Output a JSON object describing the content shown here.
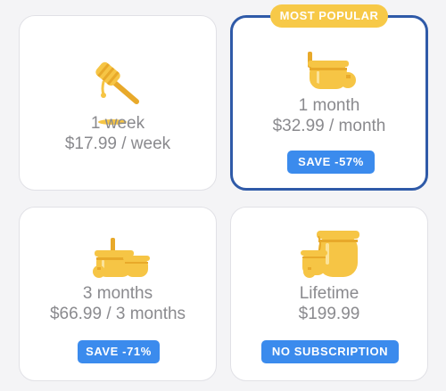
{
  "plans": [
    {
      "title": "1 week",
      "price": "$17.99 / week",
      "icon": "honey-dipper-icon"
    },
    {
      "title": "1 month",
      "price": "$32.99 / month",
      "icon": "honey-jar-small-icon",
      "badge": "MOST POPULAR",
      "button": "SAVE -57%"
    },
    {
      "title": "3 months",
      "price": "$66.99 / 3 months",
      "icon": "honey-jars-icon",
      "button": "SAVE -71%"
    },
    {
      "title": "Lifetime",
      "price": "$199.99",
      "icon": "honey-pots-icon",
      "button": "NO SUBSCRIPTION"
    }
  ],
  "colors": {
    "honey": "#f6c545",
    "honey_dark": "#e8a92a",
    "button": "#3b8bed",
    "badge": "#f7c948",
    "selected_border": "#2f5aa8",
    "text": "#8a8a8e"
  }
}
